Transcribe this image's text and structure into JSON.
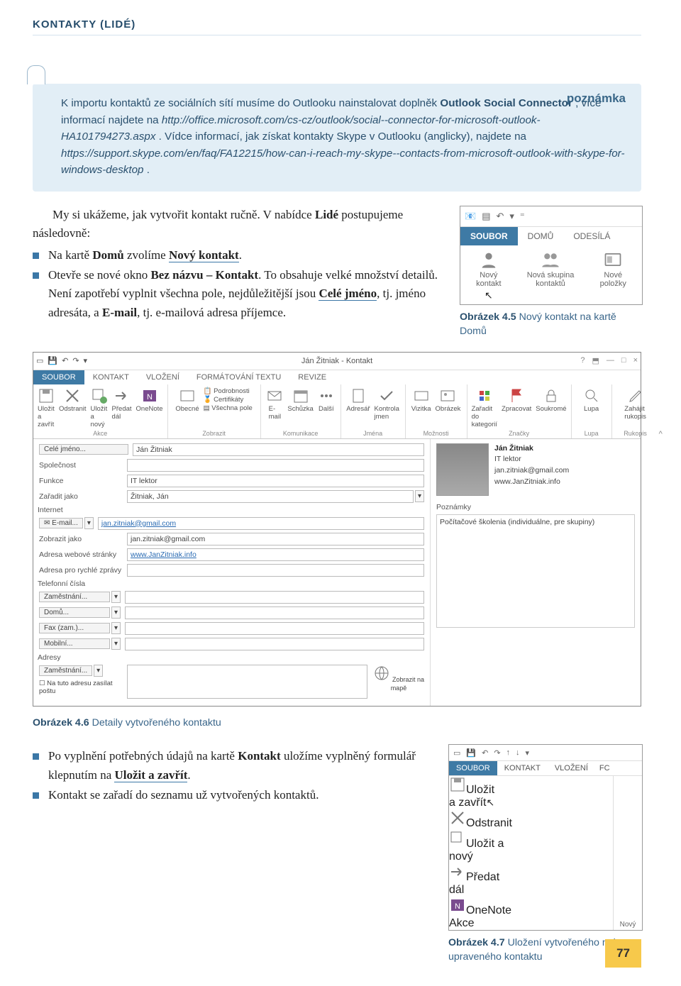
{
  "header": "KONTAKTY (LIDÉ)",
  "note": {
    "label": "poznámka",
    "line1a": "K importu kontaktů ze sociálních sítí musíme do Outlooku nainstalovat doplněk ",
    "line1b": "Outlook Social Connector",
    "line1c": "; více informací najdete na ",
    "url1": "http://office.microsoft.com/cs-cz/outlook/social--connector-for-microsoft-outlook-HA101794273.aspx",
    "line2a": ". Vídce informací, jak získat kontakty Skype v Outlooku (anglicky), najdete na ",
    "url2": "https://support.skype.com/en/faq/FA12215/how-can-i-reach-my-skype--contacts-from-microsoft-outlook-with-skype-for-windows-desktop",
    "dot": "."
  },
  "para1": {
    "intro": "My si ukážeme, jak vytvořit kontakt ručně. V nabídce ",
    "lide": "Lidé",
    "cont": " postupujeme následovně:",
    "b1a": "Na kartě ",
    "b1b": "Domů",
    "b1c": " zvolíme ",
    "b1d": "Nový kontakt",
    "b1e": ".",
    "b2a": "Otevře se nové okno ",
    "b2b": "Bez názvu – Kontakt",
    "b2c": ". To obsahuje velké množství detailů. Není zapotřebí vyplnit všechna pole, nejdůležitější jsou ",
    "b2d": "Celé jméno",
    "b2e": ", tj. jméno adresáta, a ",
    "b2f": "E-mail",
    "b2g": ", tj. e-mailová adresa příjemce."
  },
  "fig45": {
    "tabs": {
      "soubor": "SOUBOR",
      "domu": "DOMŮ",
      "odesila": "ODESÍLÁ"
    },
    "items": {
      "novy_kontakt": "Nový\nkontakt",
      "nova_skupina": "Nová skupina\nkontaktů",
      "nove_polozky": "Nové\npoložky"
    },
    "caption_b": "Obrázek 4.5",
    "caption": " Nový kontakt na kartě Domů"
  },
  "fig46": {
    "title": "Ján Žitniak - Kontakt",
    "tabs": [
      "SOUBOR",
      "KONTAKT",
      "VLOŽENÍ",
      "FORMÁTOVÁNÍ TEXTU",
      "REVIZE"
    ],
    "grp_akce": {
      "label": "Akce",
      "items": [
        "Uložit\na zavřít",
        "Odstranit",
        "Uložit a\nnový",
        "Předat\ndál",
        "OneNote"
      ]
    },
    "grp_zobrazit": {
      "label": "Zobrazit",
      "items": [
        "Obecné",
        "Podrobnosti",
        "Certifikáty",
        "Všechna pole"
      ]
    },
    "grp_kom": {
      "label": "Komunikace",
      "items": [
        "E-\nmail",
        "Schůzka",
        "Další"
      ]
    },
    "grp_jmena": {
      "label": "Jména",
      "items": [
        "Adresář",
        "Kontrola\njmen"
      ]
    },
    "grp_moznosti": {
      "label": "Možnosti",
      "items": [
        "Vizitka",
        "Obrázek"
      ]
    },
    "grp_znacky": {
      "label": "Značky",
      "items": [
        "Zařadit do\nkategorií",
        "Zpracovat",
        "Soukromé"
      ]
    },
    "grp_lupa": {
      "label": "Lupa",
      "items": [
        "Lupa"
      ]
    },
    "grp_ruk": {
      "label": "Rukopis",
      "items": [
        "Zahájit\nrukopis"
      ]
    },
    "form": {
      "cele_jmeno": {
        "label": "Celé jméno...",
        "val": "Ján Žitniak"
      },
      "spolecnost": {
        "label": "Společnost",
        "val": ""
      },
      "funkce": {
        "label": "Funkce",
        "val": "IT lektor"
      },
      "zaradit": {
        "label": "Zařadit jako",
        "val": "Žitniak, Ján"
      },
      "sect_internet": "Internet",
      "email_btn": "E-mail...",
      "email_val": "jan.zitniak@gmail.com",
      "zobrazit": {
        "label": "Zobrazit jako",
        "val": "jan.zitniak@gmail.com"
      },
      "web": {
        "label": "Adresa webové stránky",
        "val": "www.JanZitniak.info"
      },
      "im": {
        "label": "Adresa pro rychlé zprávy",
        "val": ""
      },
      "sect_tel": "Telefonní čísla",
      "tel": [
        "Zaměstnání...",
        "Domů...",
        "Fax (zam.)...",
        "Mobilní..."
      ],
      "sect_adr": "Adresy",
      "adr_btn": "Zaměstnání...",
      "adr_chk": "Na tuto adresu zasílat poštu",
      "mapbtn": "Zobrazit na\nmapě",
      "poznamky": "Poznámky",
      "poznamky_val": "Počítačové školenia (individuálne, pre skupiny)"
    },
    "card": {
      "name": "Ján Žitniak",
      "role": "IT lektor",
      "email": "jan.zitniak@gmail.com",
      "web": "www.JanZitniak.info"
    },
    "caption_b": "Obrázek 4.6",
    "caption": " Detaily vytvořeného kontaktu"
  },
  "para2": {
    "b1a": "Po vyplnění potřebných údajů na kartě ",
    "b1b": "Kontakt",
    "b1c": " uložíme vyplněný formulář klepnutím na ",
    "b1d": "Uložit a zavřít",
    "b1e": ".",
    "b2": "Kontakt se zařadí do seznamu už vytvořených kontaktů."
  },
  "fig47": {
    "tabs": [
      "SOUBOR",
      "KONTAKT",
      "VLOŽENÍ",
      "FC"
    ],
    "items": [
      "Uložit\na zavřít",
      "Odstranit",
      "Uložit a\nnový",
      "Předat\ndál",
      "OneNote"
    ],
    "grp": "Akce",
    "novy": "Nový",
    "caption_b": "Obrázek 4.7",
    "caption": " Uložení vytvořeného nebo upraveného kontaktu"
  },
  "page_num": "77"
}
